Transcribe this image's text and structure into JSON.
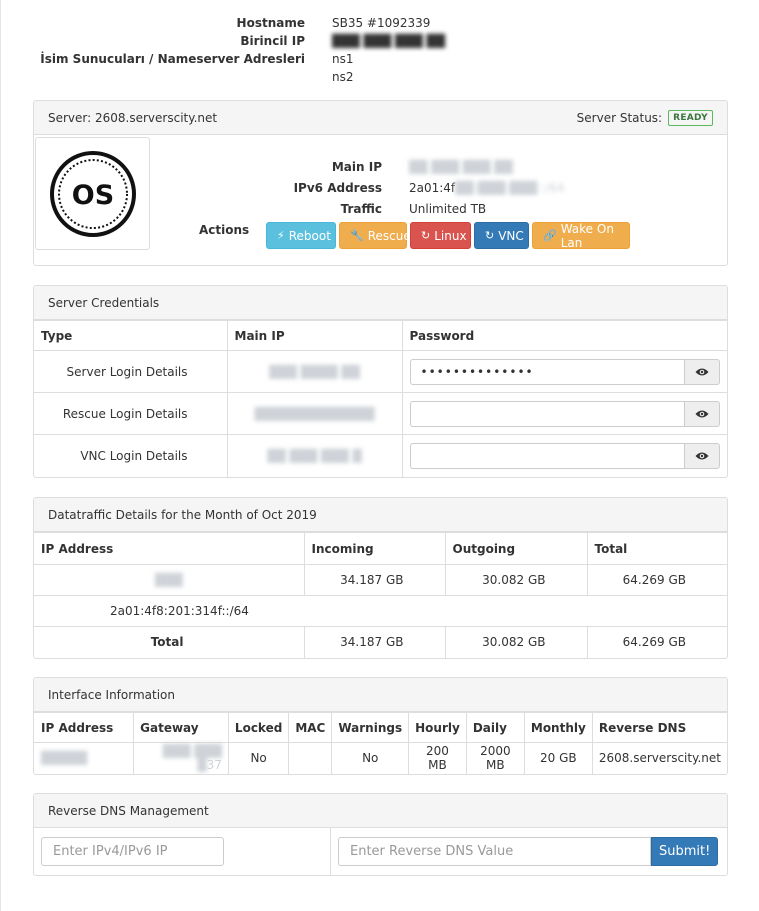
{
  "top": {
    "hostname_label": "Hostname",
    "hostname_value": "SB35 #1092339",
    "primary_ip_label": "Birincil IP",
    "primary_ip_value": "",
    "nameserver_label": "İsim Sunucuları / Nameserver Adresleri",
    "ns1": "ns1",
    "ns2": "ns2"
  },
  "server": {
    "title": "Server: 2608.serverscity.net",
    "status_label": "Server Status:",
    "status_value": "READY",
    "os_logo_text": "OS",
    "main_ip_label": "Main IP",
    "main_ip_value": "",
    "ipv6_label": "IPv6 Address",
    "ipv6_value": "2a01:4f",
    "traffic_label": "Traffic",
    "traffic_value": "Unlimited TB",
    "actions_label": "Actions",
    "buttons": {
      "reboot": "Reboot",
      "rescue": "Rescue",
      "linux": "Linux",
      "vnc": "VNC",
      "wake": "Wake On Lan"
    }
  },
  "credentials": {
    "title": "Server Credentials",
    "headers": [
      "Type",
      "Main IP",
      "Password"
    ],
    "rows": [
      {
        "type": "Server Login Details",
        "password": "••••••••••••••"
      },
      {
        "type": "Rescue Login Details",
        "password": ""
      },
      {
        "type": "VNC Login Details",
        "password": ""
      }
    ]
  },
  "traffic": {
    "title": "Datatraffic Details for the Month of Oct 2019",
    "headers": [
      "IP Address",
      "Incoming",
      "Outgoing",
      "Total"
    ],
    "row1": {
      "ip": "",
      "incoming": "34.187 GB",
      "outgoing": "30.082 GB",
      "total": "64.269 GB"
    },
    "row2": {
      "ip": "2a01:4f8:201:314f::/64"
    },
    "total": {
      "label": "Total",
      "incoming": "34.187 GB",
      "outgoing": "30.082 GB",
      "total": "64.269 GB"
    }
  },
  "interface": {
    "title": "Interface Information",
    "headers": [
      "IP Address",
      "Gateway",
      "Locked",
      "MAC",
      "Warnings",
      "Hourly",
      "Daily",
      "Monthly",
      "Reverse DNS"
    ],
    "row": {
      "ip": "",
      "gateway": "37",
      "locked": "No",
      "mac": "",
      "warnings": "No",
      "hourly": "200 MB",
      "daily": "2000 MB",
      "monthly": "20 GB",
      "rdns": "2608.serverscity.net"
    }
  },
  "rdns": {
    "title": "Reverse DNS Management",
    "ip_placeholder": "Enter IPv4/IPv6 IP",
    "value_placeholder": "Enter Reverse DNS Value",
    "submit": "Submit!"
  },
  "colors": {
    "info": "#5bc0de",
    "warning": "#f0ad4e",
    "danger": "#d9534f",
    "primary": "#337ab7",
    "ready": "#5cb85c"
  }
}
